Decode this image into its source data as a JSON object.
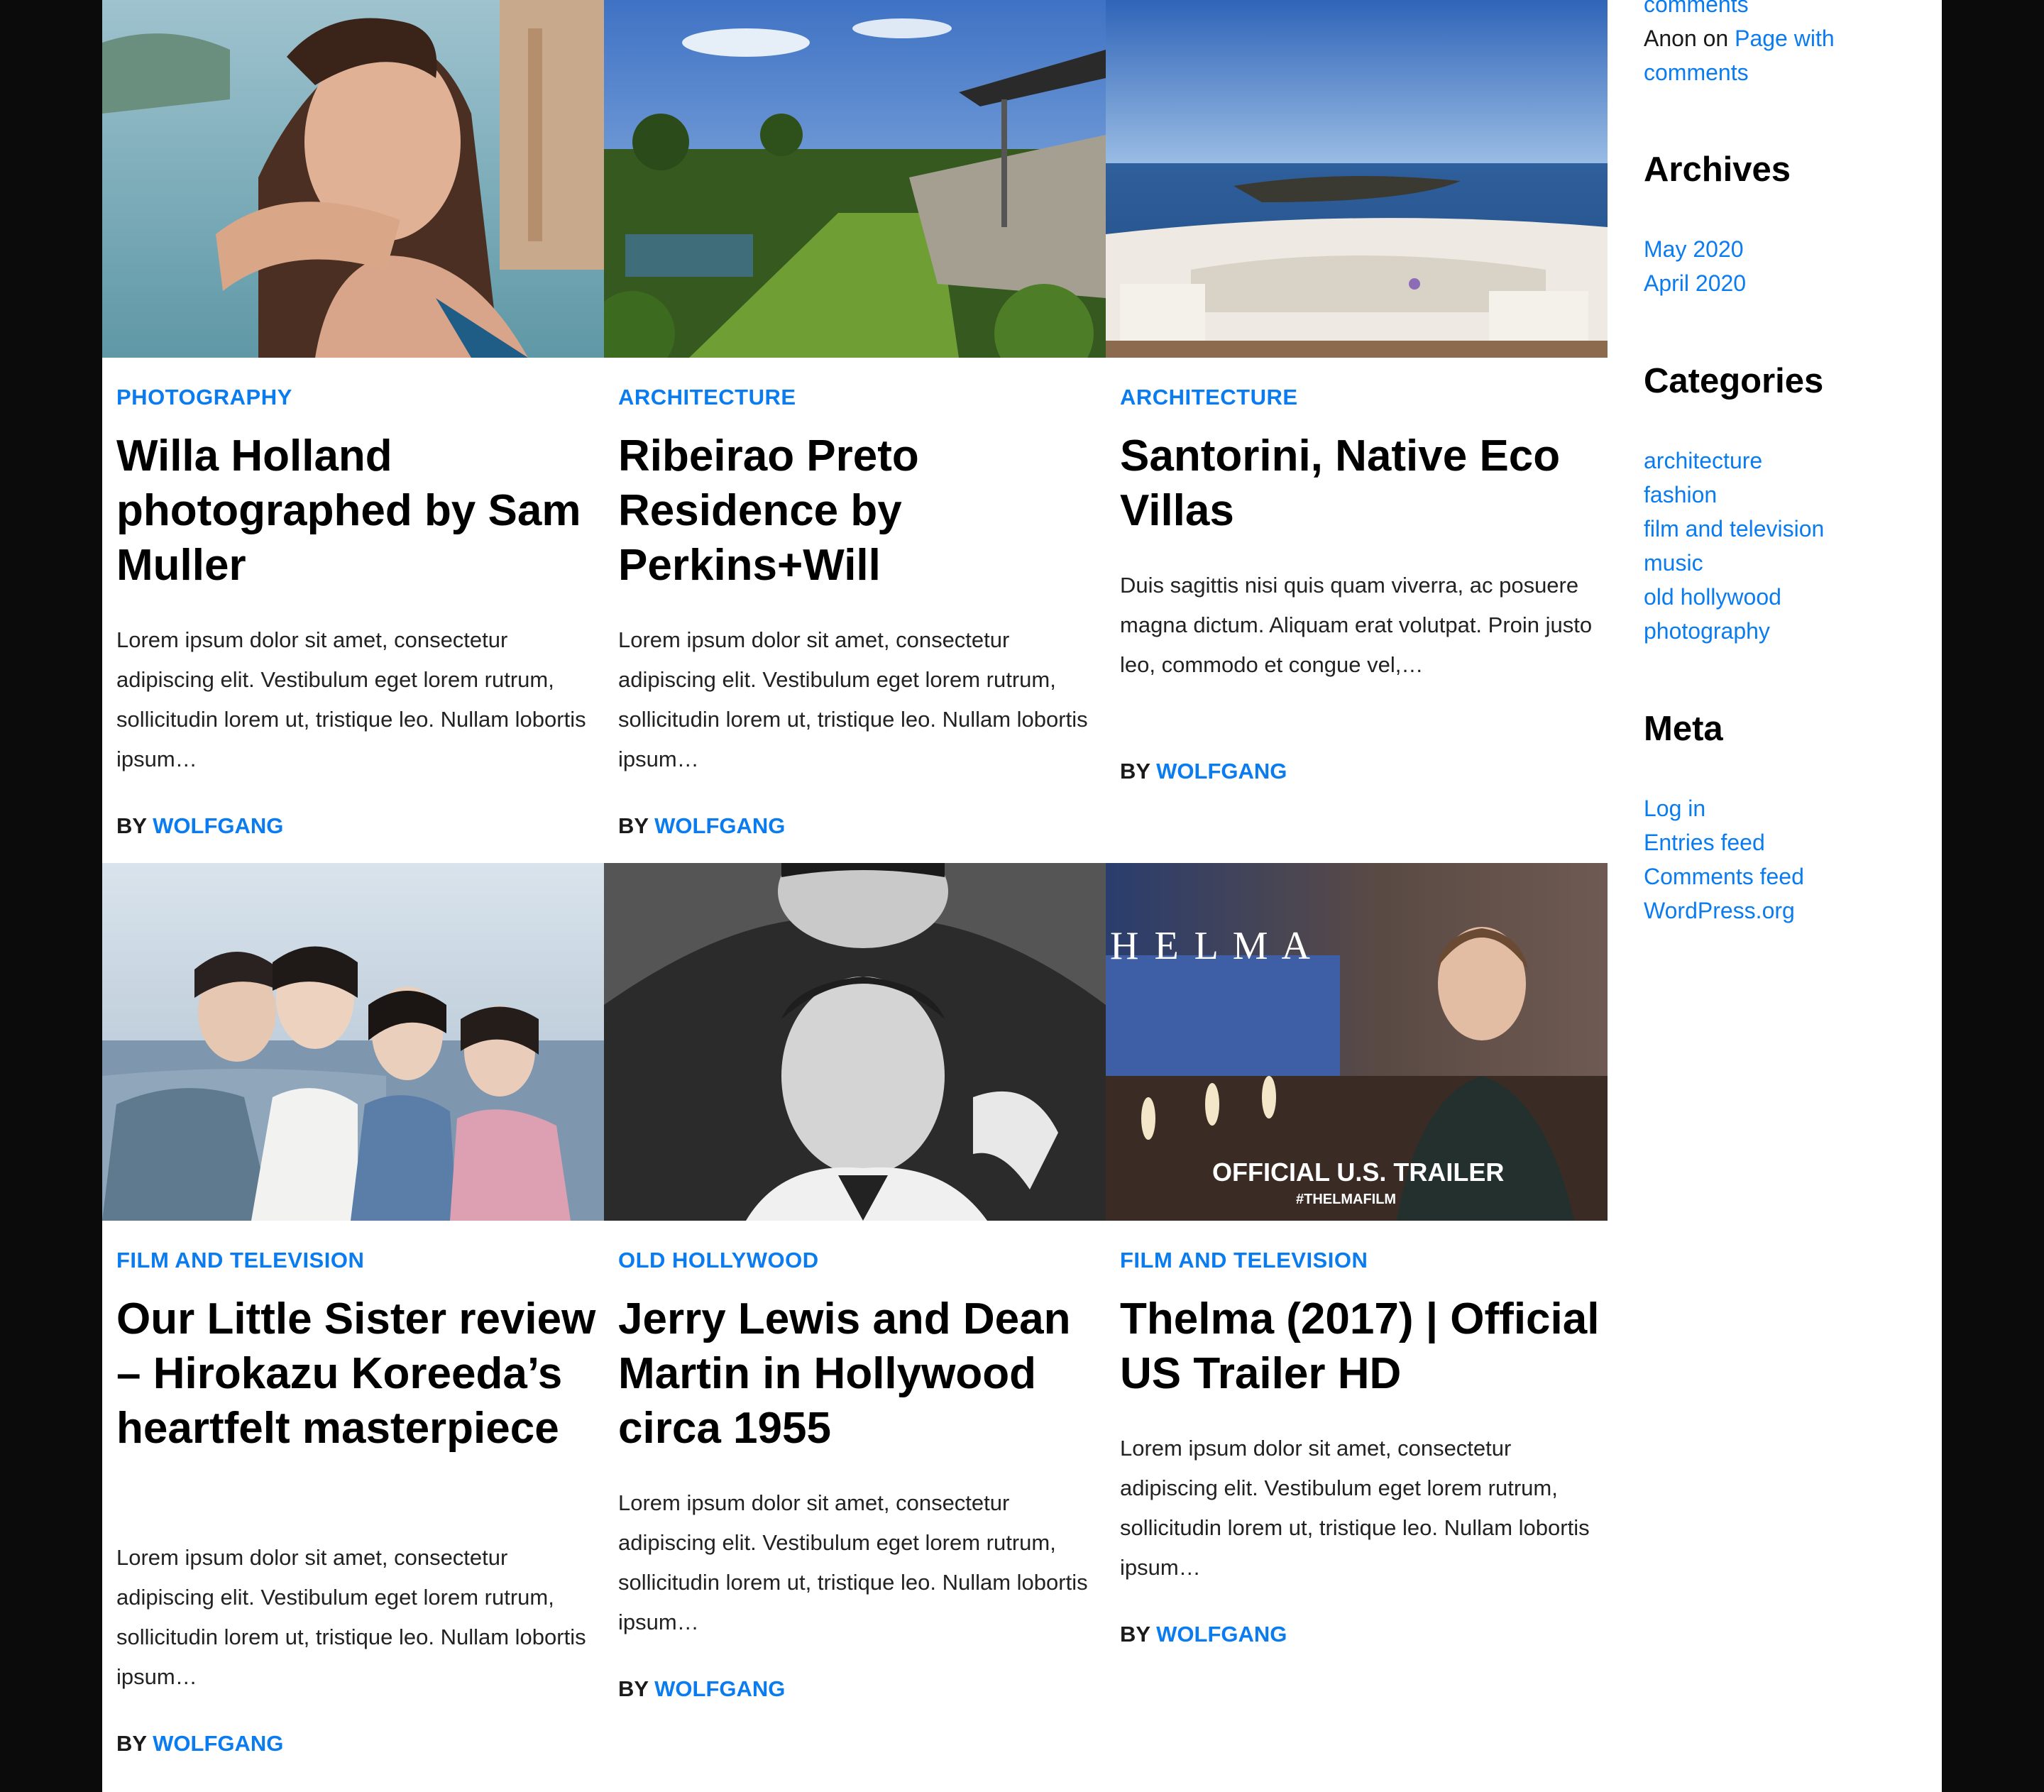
{
  "posts": [
    {
      "category": "PHOTOGRAPHY",
      "title": "Willa Holland photographed by Sam Muller",
      "excerpt": "Lorem ipsum dolor sit amet, consectetur adipiscing elit. Vestibulum eget lorem rutrum, sollicitudin lorem ut, tristique leo. Nullam lobortis ipsum…",
      "by": "BY",
      "author": "WOLFGANG"
    },
    {
      "category": "ARCHITECTURE",
      "title": "Ribeirao Preto Residence by Perkins+Will",
      "excerpt": "Lorem ipsum dolor sit amet, consectetur adipiscing elit. Vestibulum eget lorem rutrum, sollicitudin lorem ut, tristique leo. Nullam lobortis ipsum…",
      "by": "BY",
      "author": "WOLFGANG"
    },
    {
      "category": "ARCHITECTURE",
      "title": "Santorini, Native Eco Villas",
      "excerpt": "Duis sagittis nisi quis quam viverra, ac posuere magna dictum. Aliquam erat volutpat. Proin justo leo, commodo et congue vel,…",
      "by": "BY",
      "author": "WOLFGANG"
    },
    {
      "category": "FILM AND TELEVISION",
      "title": "Our Little Sister review – Hirokazu Koreeda’s heartfelt masterpiece",
      "excerpt": "Lorem ipsum dolor sit amet, consectetur adipiscing elit. Vestibulum eget lorem rutrum, sollicitudin lorem ut, tristique leo. Nullam lobortis ipsum…",
      "by": "BY",
      "author": "WOLFGANG"
    },
    {
      "category": "OLD HOLLYWOOD",
      "title": "Jerry Lewis and Dean Martin in Hollywood circa 1955",
      "excerpt": "Lorem ipsum dolor sit amet, consectetur adipiscing elit. Vestibulum eget lorem rutrum, sollicitudin lorem ut, tristique leo. Nullam lobortis ipsum…",
      "by": "BY",
      "author": "WOLFGANG"
    },
    {
      "category": "FILM AND TELEVISION",
      "title": "Thelma (2017) | Official US Trailer HD",
      "excerpt": "Lorem ipsum dolor sit amet, consectetur adipiscing elit. Vestibulum eget lorem rutrum, sollicitudin lorem ut, tristique leo. Nullam lobortis ipsum…",
      "by": "BY",
      "author": "WOLFGANG"
    }
  ],
  "thelma_image": {
    "title_letters": "H E L M A",
    "overlay_main": "OFFICIAL U.S. TRAILER",
    "overlay_tag": "#THELMAFILM"
  },
  "sidebar": {
    "recent_comments": {
      "partial_link": "comments",
      "author": "Anon",
      "on": "on",
      "link_line1": "Page with",
      "link_line2": "comments"
    },
    "archives": {
      "heading": "Archives",
      "items": [
        "May 2020",
        "April 2020"
      ]
    },
    "categories": {
      "heading": "Categories",
      "items": [
        "architecture",
        "fashion",
        "film and television",
        "music",
        "old hollywood",
        "photography"
      ]
    },
    "meta": {
      "heading": "Meta",
      "items": [
        "Log in",
        "Entries feed",
        "Comments feed",
        "WordPress.org"
      ]
    }
  },
  "colors": {
    "link": "#0a7cf0",
    "background_frame": "#0b0b0b",
    "content_bg": "#ffffff"
  }
}
